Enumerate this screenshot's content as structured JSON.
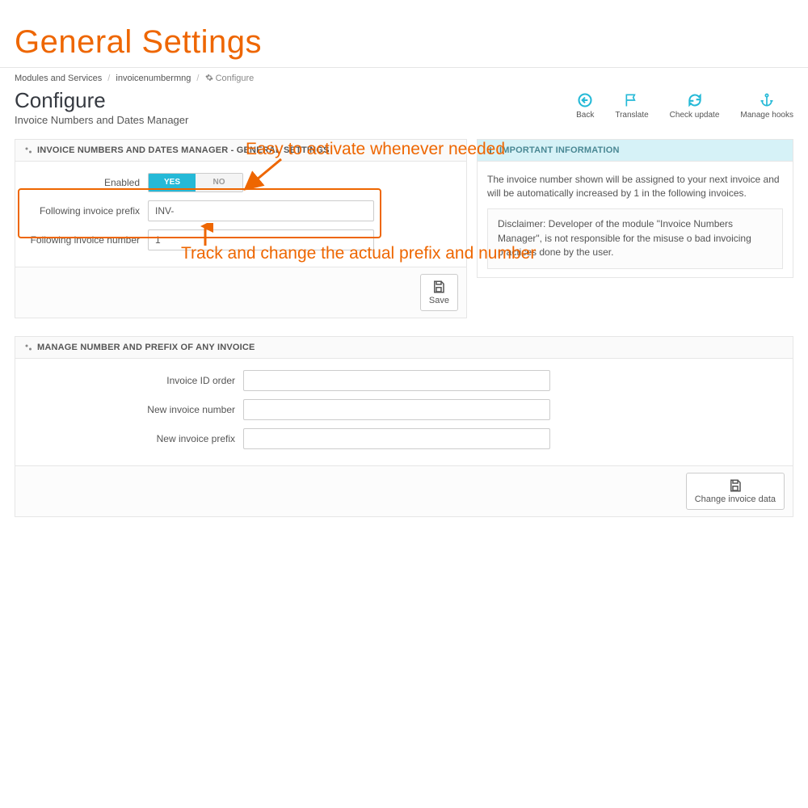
{
  "page_title": "General Settings",
  "breadcrumb": {
    "root": "Modules and Services",
    "module": "invoicenumbermng",
    "current": "Configure"
  },
  "header": {
    "title": "Configure",
    "subtitle": "Invoice Numbers and Dates Manager"
  },
  "toolbar": {
    "back": "Back",
    "translate": "Translate",
    "check_update": "Check update",
    "manage_hooks": "Manage hooks"
  },
  "annotations": {
    "activate": "Easy to activate whenever needed",
    "track": "Track and change the actual prefix and number"
  },
  "panel_general": {
    "heading": "INVOICE NUMBERS AND DATES MANAGER - GENERAL SETTINGS",
    "enabled_label": "Enabled",
    "enabled_yes": "YES",
    "enabled_no": "NO",
    "prefix_label": "Following invoice prefix",
    "prefix_value": "INV-",
    "number_label": "Following invoice number",
    "number_value": "1",
    "save_label": "Save"
  },
  "panel_info": {
    "heading": "IMPORTANT INFORMATION",
    "text": "The invoice number shown will be assigned to your next invoice and will be automatically increased by 1 in the following invoices.",
    "disclaimer": "Disclaimer: Developer of the module \"Invoice Numbers Manager\", is not responsible for the misuse o bad invoicing practices done by the user."
  },
  "panel_manage": {
    "heading": "MANAGE NUMBER AND PREFIX OF ANY INVOICE",
    "id_label": "Invoice ID order",
    "number_label": "New invoice number",
    "prefix_label": "New invoice prefix",
    "change_label": "Change invoice data"
  }
}
